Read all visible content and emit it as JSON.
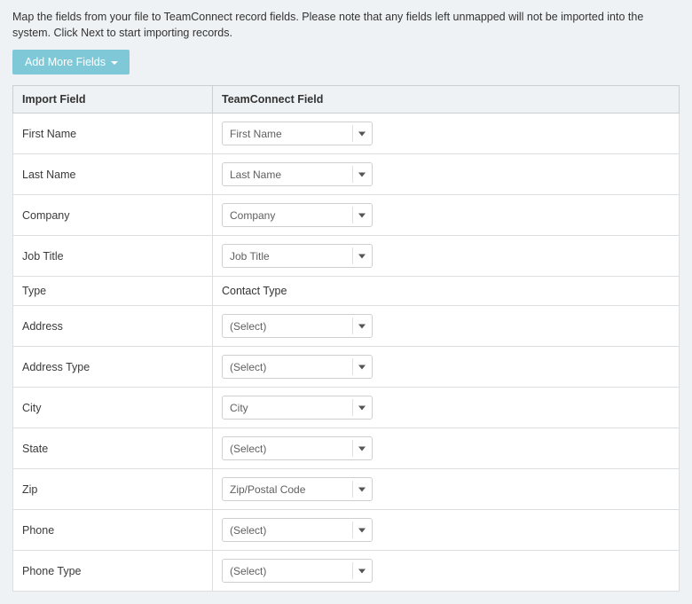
{
  "instructions": "Map the fields from your file to TeamConnect record fields. Please note that any fields left unmapped will not be imported into the system. Click Next to start importing records.",
  "addMoreFieldsLabel": "Add More Fields",
  "tableHeaders": {
    "importField": "Import Field",
    "teamconnectField": "TeamConnect Field"
  },
  "rows": [
    {
      "importField": "First Name",
      "type": "select",
      "value": "First Name"
    },
    {
      "importField": "Last Name",
      "type": "select",
      "value": "Last Name"
    },
    {
      "importField": "Company",
      "type": "select",
      "value": "Company"
    },
    {
      "importField": "Job Title",
      "type": "select",
      "value": "Job Title"
    },
    {
      "importField": "Type",
      "type": "static",
      "value": "Contact Type"
    },
    {
      "importField": "Address",
      "type": "select",
      "value": "(Select)"
    },
    {
      "importField": "Address Type",
      "type": "select",
      "value": "(Select)"
    },
    {
      "importField": "City",
      "type": "select",
      "value": "City"
    },
    {
      "importField": "State",
      "type": "select",
      "value": "(Select)"
    },
    {
      "importField": "Zip",
      "type": "select",
      "value": "Zip/Postal Code"
    },
    {
      "importField": "Phone",
      "type": "select",
      "value": "(Select)"
    },
    {
      "importField": "Phone Type",
      "type": "select",
      "value": "(Select)"
    }
  ]
}
